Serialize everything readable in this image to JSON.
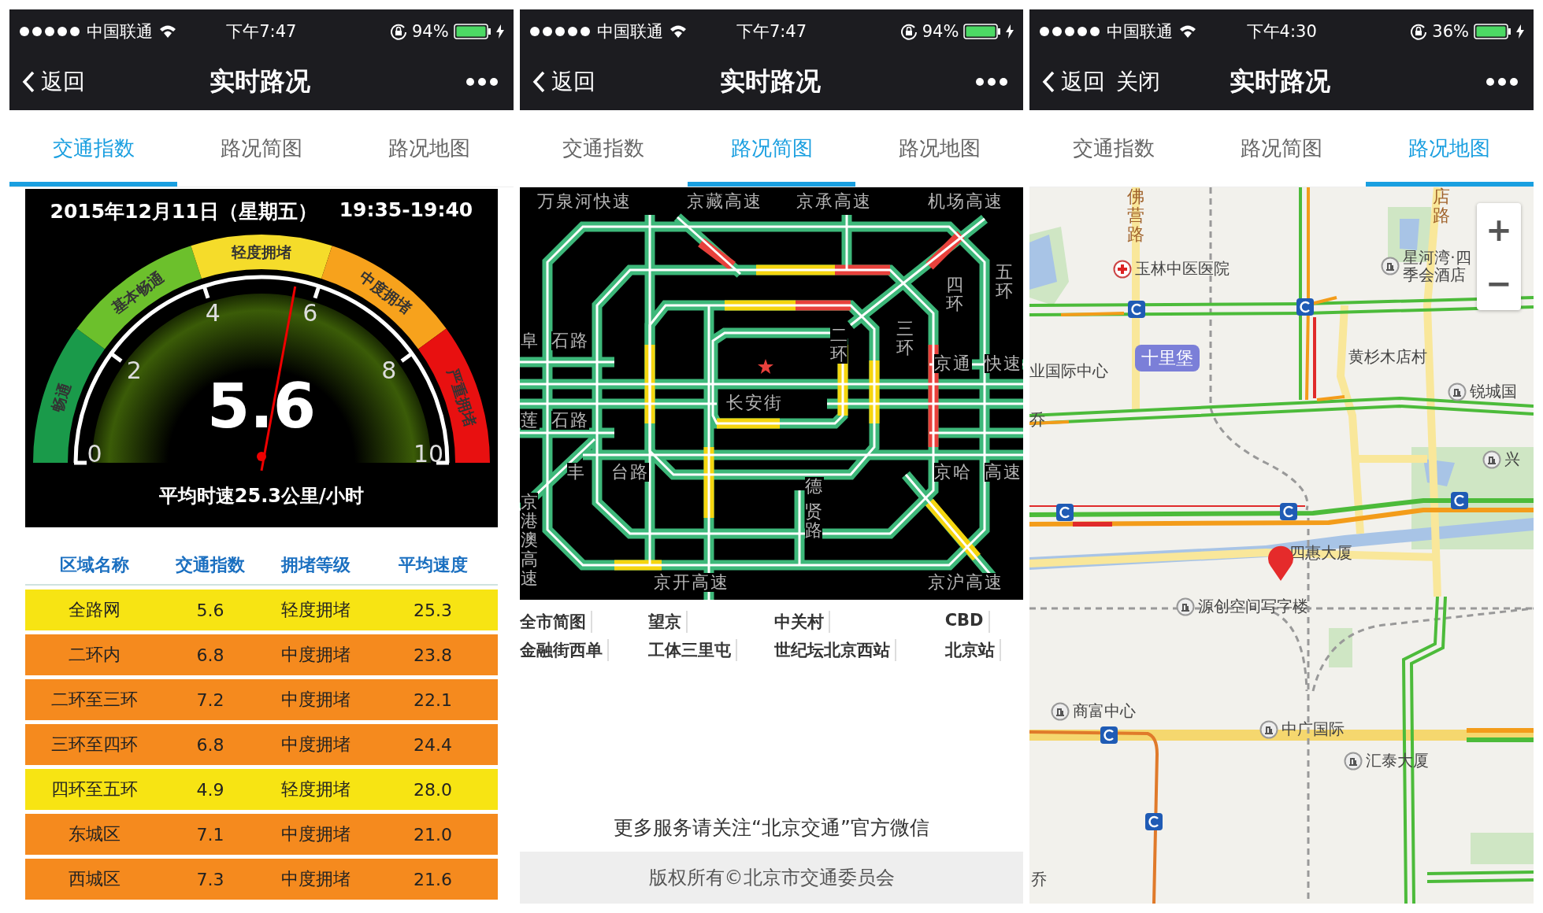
{
  "phones": [
    {
      "status": {
        "carrier": "中国联通",
        "time": "下午7:47",
        "battery": "94%"
      },
      "nav": {
        "back": "返回",
        "title": "实时路况"
      },
      "tabs": [
        {
          "label": "交通指数",
          "selected": true
        },
        {
          "label": "路况简图",
          "selected": false
        },
        {
          "label": "路况地图",
          "selected": false
        }
      ],
      "content": {
        "kind": "index",
        "date": "2015年12月11日（星期五）",
        "period": "19:35-19:40",
        "bands": [
          {
            "label": "畅通",
            "color": "#1a9a4a"
          },
          {
            "label": "基本畅通",
            "color": "#6cc02c"
          },
          {
            "label": "轻度拥堵",
            "color": "#f5dc2a"
          },
          {
            "label": "中度拥堵",
            "color": "#f7a21c"
          },
          {
            "label": "严重拥堵",
            "color": "#e81010"
          }
        ],
        "ticks": [
          "0",
          "2",
          "4",
          "6",
          "8",
          "10"
        ],
        "value": "5.6",
        "level": 0.56,
        "speed": "平均时速25.3公里/小时",
        "table": {
          "columns": [
            "区域名称",
            "交通指数",
            "拥堵等级",
            "平均速度"
          ],
          "rows": [
            {
              "cells": [
                "全路网",
                "5.6",
                "轻度拥堵",
                "25.3"
              ],
              "color": "#f7e413"
            },
            {
              "cells": [
                "二环内",
                "6.8",
                "中度拥堵",
                "23.8"
              ],
              "color": "#f58a1e"
            },
            {
              "cells": [
                "二环至三环",
                "7.2",
                "中度拥堵",
                "22.1"
              ],
              "color": "#f58a1e"
            },
            {
              "cells": [
                "三环至四环",
                "6.8",
                "中度拥堵",
                "24.4"
              ],
              "color": "#f58a1e"
            },
            {
              "cells": [
                "四环至五环",
                "4.9",
                "轻度拥堵",
                "28.0"
              ],
              "color": "#f7e413"
            },
            {
              "cells": [
                "东城区",
                "7.1",
                "中度拥堵",
                "21.0"
              ],
              "color": "#f58a1e"
            },
            {
              "cells": [
                "西城区",
                "7.3",
                "中度拥堵",
                "21.6"
              ],
              "color": "#f58a1e"
            }
          ]
        }
      }
    },
    {
      "status": {
        "carrier": "中国联通",
        "time": "下午7:47",
        "battery": "94%"
      },
      "nav": {
        "back": "返回",
        "title": "实时路况"
      },
      "tabs": [
        {
          "label": "交通指数",
          "selected": false
        },
        {
          "label": "路况简图",
          "selected": true
        },
        {
          "label": "路况地图",
          "selected": false
        }
      ],
      "content": {
        "kind": "diagram",
        "labels": [
          {
            "text": "万泉河快速"
          },
          {
            "text": "京藏高速"
          },
          {
            "text": "京承高速"
          },
          {
            "text": "机场高速"
          },
          {
            "text": "二环"
          },
          {
            "text": "三环"
          },
          {
            "text": "四环"
          },
          {
            "text": "五环"
          },
          {
            "text": "阜"
          },
          {
            "text": "石路"
          },
          {
            "text": "京通"
          },
          {
            "text": "快速"
          },
          {
            "text": "长安街"
          },
          {
            "text": "莲"
          },
          {
            "text": "石路"
          },
          {
            "text": "丰"
          },
          {
            "text": "台路"
          },
          {
            "text": "京哈"
          },
          {
            "text": "高速"
          },
          {
            "text": "德"
          },
          {
            "text": "贤路"
          },
          {
            "text": "京港澳高速"
          },
          {
            "text": "京开高速"
          },
          {
            "text": "京沪高速"
          }
        ],
        "links": [
          "全市简图",
          "望京",
          "中关村",
          "CBD",
          "金融街西单",
          "工体三里屯",
          "世纪坛北京西站",
          "北京站"
        ],
        "notice": "更多服务请关注“北京交通”官方微信",
        "copyright": "版权所有©北京市交通委员会"
      }
    },
    {
      "status": {
        "carrier": "中国联通",
        "time": "下午4:30",
        "battery": "36%"
      },
      "nav": {
        "back": "返回",
        "close": "关闭",
        "title": "实时路况"
      },
      "tabs": [
        {
          "label": "交通指数",
          "selected": false
        },
        {
          "label": "路况简图",
          "selected": false
        },
        {
          "label": "路况地图",
          "selected": true
        }
      ],
      "content": {
        "kind": "map",
        "zoom_in": "+",
        "zoom_out": "−",
        "labels": [
          {
            "text": "佛营路",
            "kind": "road"
          },
          {
            "text": "店路",
            "kind": "road"
          },
          {
            "text": "玉林中医医院",
            "kind": "hospital"
          },
          {
            "text": "星河湾·四季会酒店",
            "kind": "poi"
          },
          {
            "text": "十里堡",
            "kind": "area"
          },
          {
            "text": "业国际中心",
            "kind": "place"
          },
          {
            "text": "黄杉木店村",
            "kind": "place"
          },
          {
            "text": "乔",
            "kind": "place"
          },
          {
            "text": "锐城国",
            "kind": "poi"
          },
          {
            "text": "兴",
            "kind": "poi"
          },
          {
            "text": "四惠大厦",
            "kind": "place"
          },
          {
            "text": "源创空间写字楼",
            "kind": "poi"
          },
          {
            "text": "商富中心",
            "kind": "poi"
          },
          {
            "text": "中广国际",
            "kind": "poi"
          },
          {
            "text": "汇泰大厦",
            "kind": "poi"
          },
          {
            "text": "乔",
            "kind": "place"
          }
        ]
      }
    }
  ]
}
